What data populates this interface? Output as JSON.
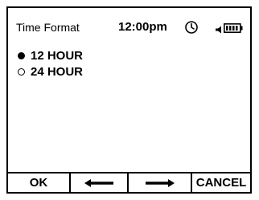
{
  "status_bar": {
    "title": "Time Format",
    "clock": "12:00pm",
    "icons": [
      "clock-icon",
      "speaker-icon",
      "battery-icon"
    ]
  },
  "options": [
    {
      "label": "12 HOUR",
      "selected": true
    },
    {
      "label": "24 HOUR",
      "selected": false
    }
  ],
  "softkeys": {
    "ok": "OK",
    "left_icon": "left-arrow-icon",
    "right_icon": "right-arrow-icon",
    "cancel": "CANCEL"
  }
}
